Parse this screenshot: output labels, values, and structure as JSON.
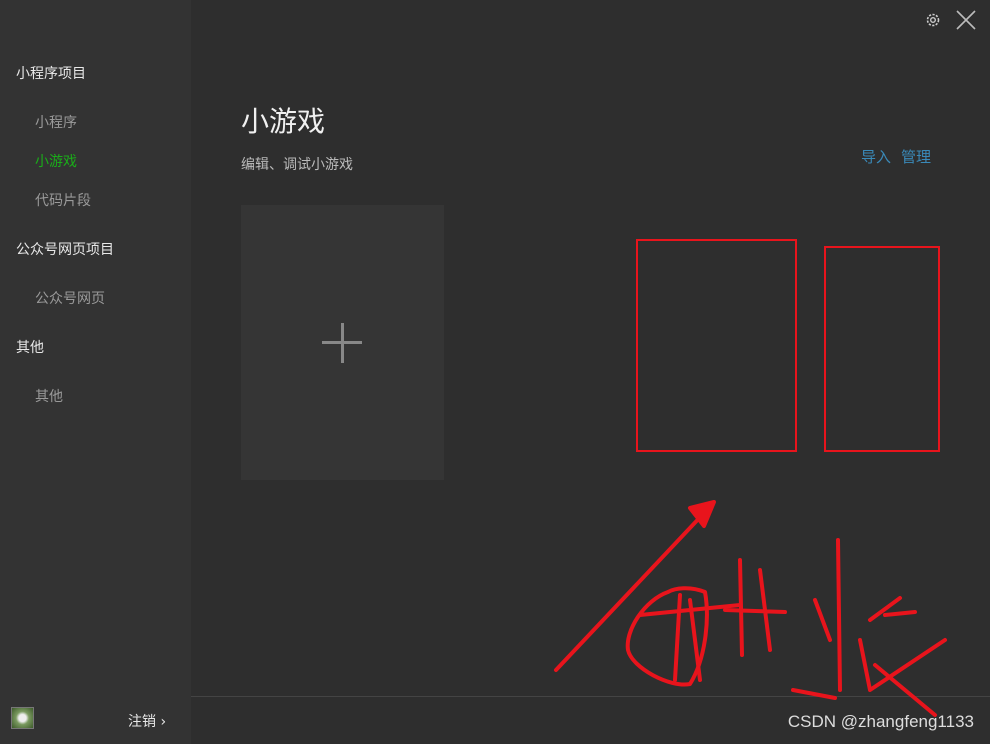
{
  "sidebar": {
    "sections": [
      {
        "label": "小程序项目",
        "items": [
          {
            "label": "小程序"
          },
          {
            "label": "小游戏",
            "active": true
          },
          {
            "label": "代码片段"
          }
        ]
      },
      {
        "label": "公众号网页项目",
        "items": [
          {
            "label": "公众号网页"
          }
        ]
      },
      {
        "label": "其他",
        "items": [
          {
            "label": "其他"
          }
        ]
      }
    ],
    "logout": "注销 ›"
  },
  "main": {
    "title": "小游戏",
    "subtitle": "编辑、调试小游戏",
    "import": "导入",
    "manage": "管理"
  },
  "annotation": {
    "text": "删除",
    "color": "#e8141c"
  },
  "watermark": "CSDN @zhangfeng1133",
  "colors": {
    "accent": "#1aad19",
    "link": "#3a89b8"
  }
}
